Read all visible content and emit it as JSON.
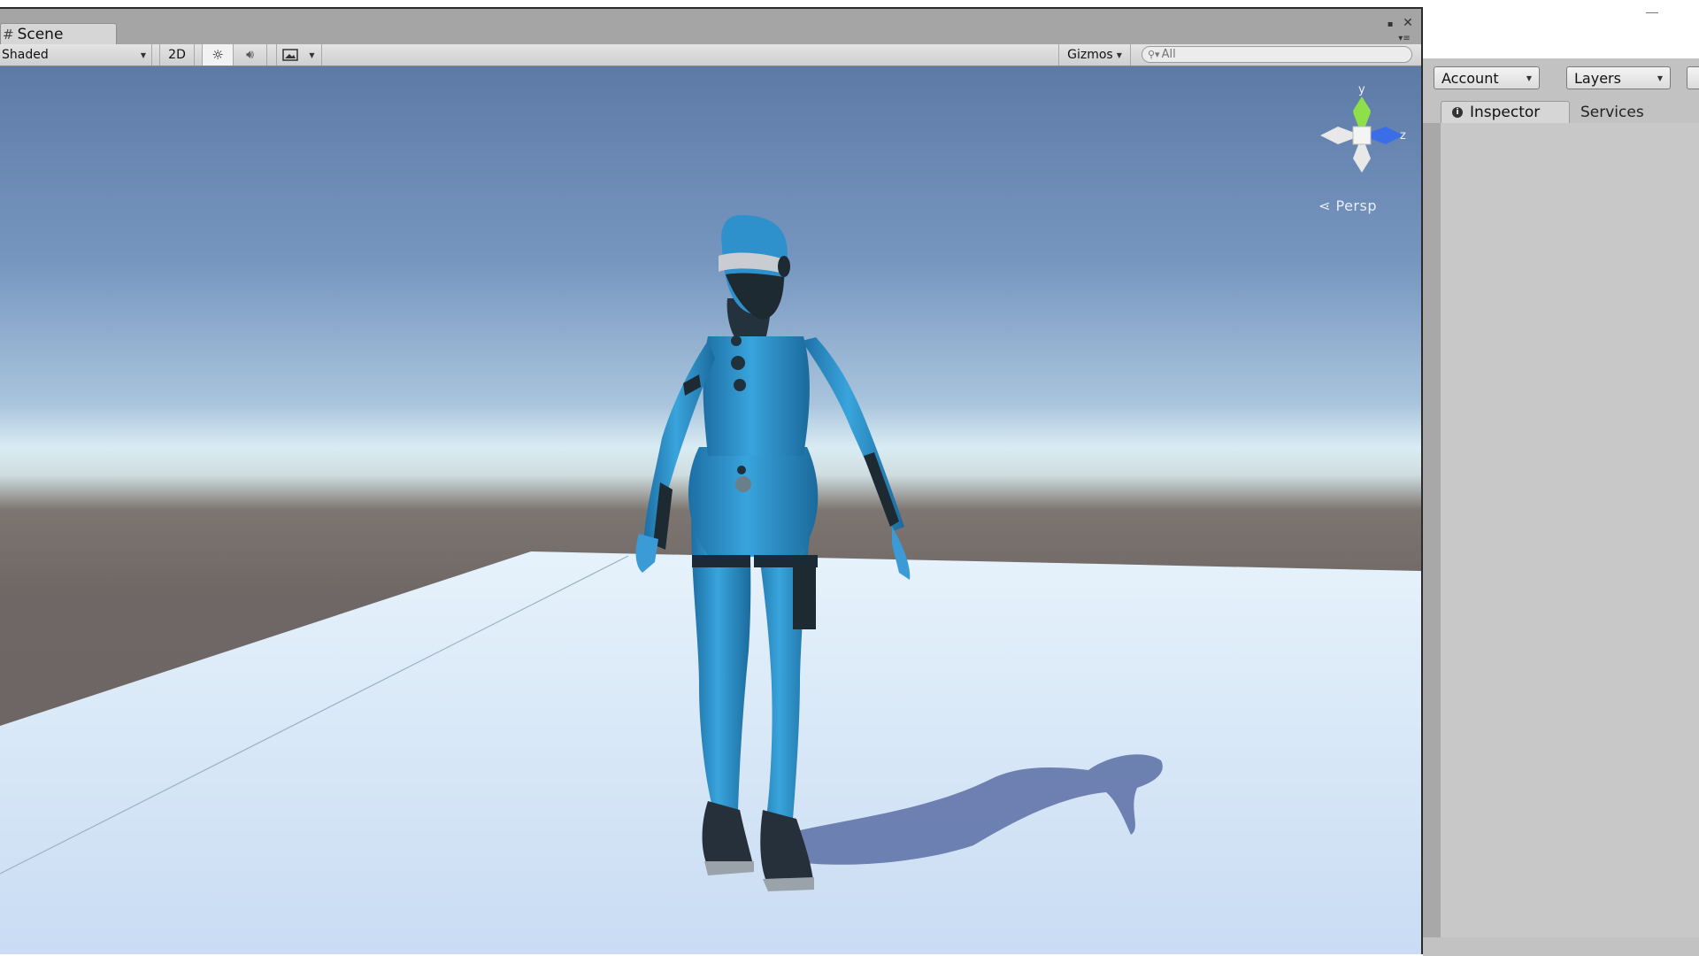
{
  "scene_window": {
    "tab_label": "Scene",
    "toolbar": {
      "shading_mode": "Shaded",
      "mode_2d": "2D",
      "gizmos_label": "Gizmos",
      "search_placeholder": "All"
    },
    "viewport": {
      "projection_label": "Persp",
      "axis_labels": {
        "y": "y",
        "z": "z"
      }
    }
  },
  "right_panel": {
    "account_label": "Account",
    "layers_label": "Layers",
    "tabs": [
      {
        "label": "Inspector",
        "active": true
      },
      {
        "label": "Services",
        "active": false
      }
    ]
  },
  "colors": {
    "suit_blue": "#2a8fc8",
    "axis_y": "#8ee04a",
    "axis_z": "#3a6ee8"
  }
}
